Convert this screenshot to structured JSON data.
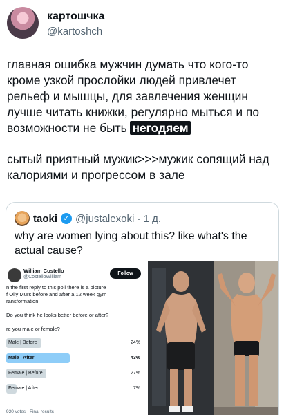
{
  "tweet": {
    "display_name": "картошчка",
    "handle": "@kartoshch",
    "text_line1": "главная ошибка мужчин думать что кого-то кроме узкой прослойки людей привлечет рельеф и мышцы, для завлечения женщин лучше читать книжки, регулярно мыться и по возможности не быть",
    "highlight_word": "негодяем",
    "text_para2": "сытый приятный мужик>>>мужик сопящий над калориями и прогрессом в зале"
  },
  "quote": {
    "display_name": "taoki",
    "verified_glyph": "✓",
    "handle_time": "@justalexoki · 1 д.",
    "text": "why are women lying about this? like what's the actual cause?"
  },
  "embedded_poll": {
    "author_name": "William Costello",
    "author_handle": "@CostelloWilliam",
    "follow_label": "Follow",
    "line1": "n the first reply to this poll there is a picture",
    "line2": "f Olly Murs before and after a 12 week gym",
    "line3": "ransformation.",
    "question1": "Do you think he looks better before or after?",
    "question2": "re you male or female?",
    "options": [
      {
        "label": "Male | Before",
        "pct": "24%",
        "value": 24,
        "winner": false
      },
      {
        "label": "Male | After",
        "pct": "43%",
        "value": 43,
        "winner": true
      },
      {
        "label": "Female | Before",
        "pct": "27%",
        "value": 27,
        "winner": false
      },
      {
        "label": "Female | After",
        "pct": "7%",
        "value": 7,
        "winner": false
      }
    ],
    "votes": "920 votes · Final results"
  },
  "colors": {
    "accent": "#1d9bf0",
    "poll_winner": "#8ecdf8",
    "poll_bar": "#cfd9de",
    "text_secondary": "#536471"
  }
}
